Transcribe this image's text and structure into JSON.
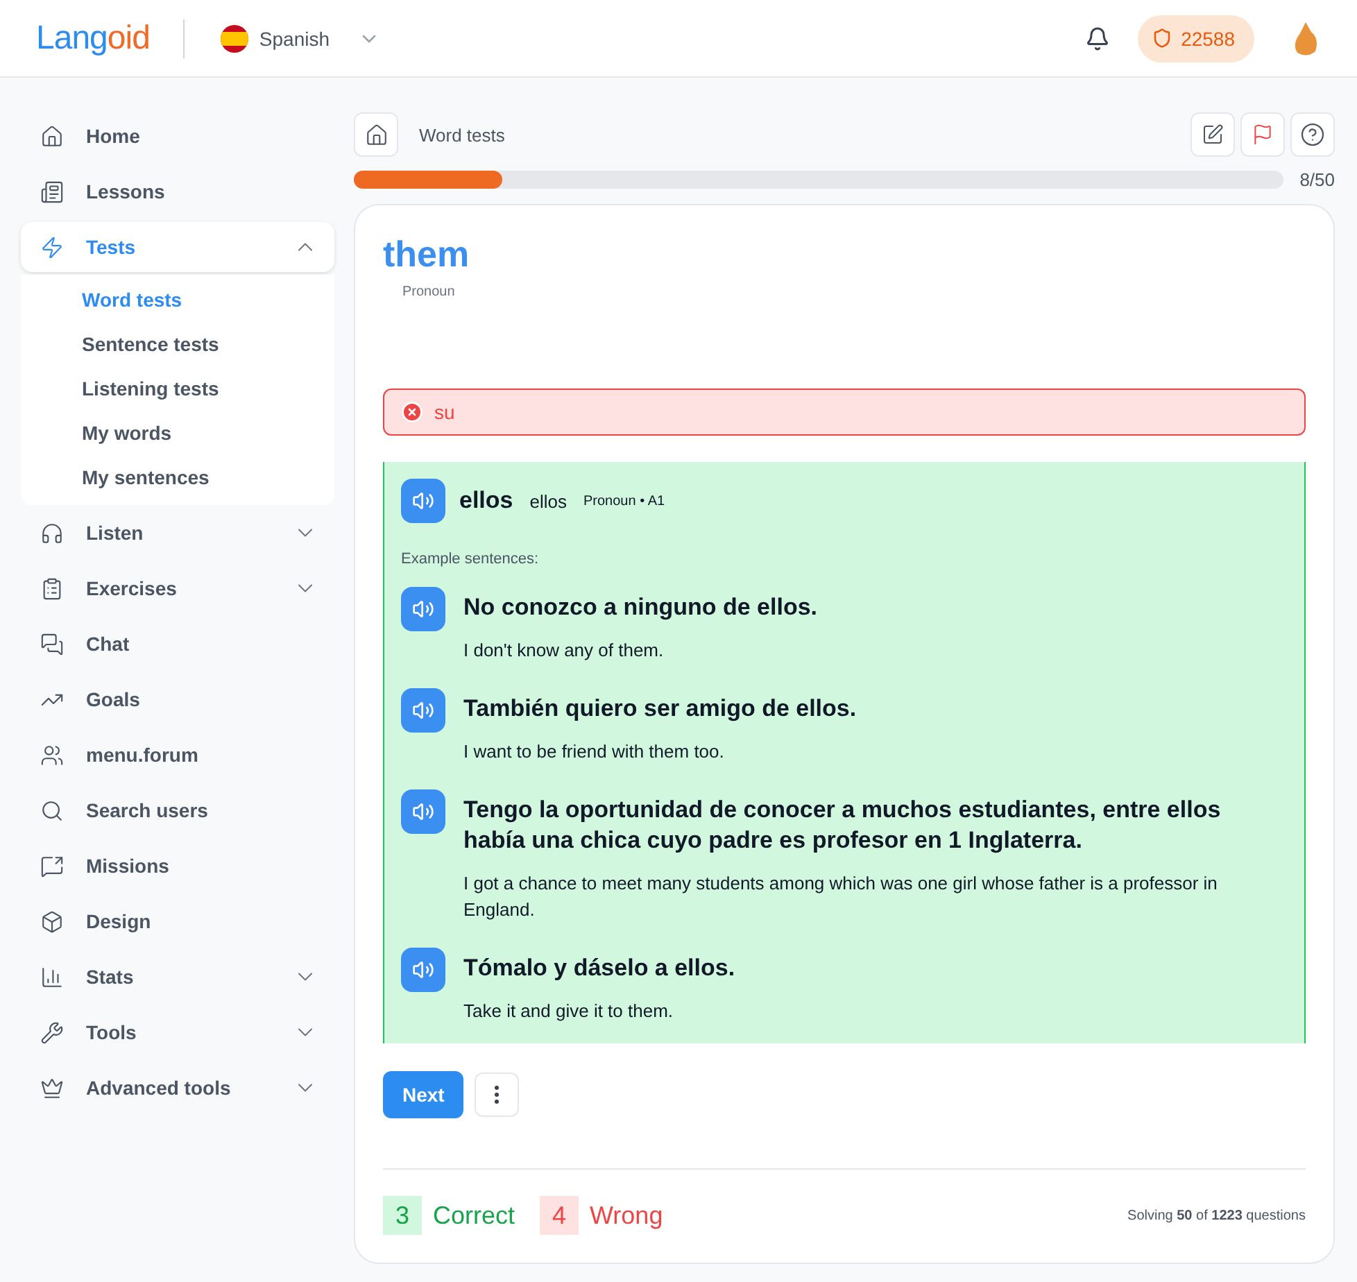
{
  "header": {
    "logo": [
      {
        "text": "Lang",
        "color": "#2d8cf0"
      },
      {
        "text": "oid",
        "color": "#f06a28"
      }
    ],
    "language": "Spanish",
    "points": "22588"
  },
  "sidebar": {
    "items": [
      {
        "label": "Home",
        "selected": false
      },
      {
        "label": "Lessons",
        "selected": false
      },
      {
        "label": "Tests",
        "selected": true,
        "expanded": true,
        "children": [
          {
            "label": "Word tests",
            "selected": true
          },
          {
            "label": "Sentence tests",
            "selected": false
          },
          {
            "label": "Listening tests",
            "selected": false
          },
          {
            "label": "My words",
            "selected": false
          },
          {
            "label": "My sentences",
            "selected": false
          }
        ]
      },
      {
        "label": "Listen",
        "selected": false,
        "expanded": false
      },
      {
        "label": "Exercises",
        "selected": false,
        "expanded": false
      },
      {
        "label": "Chat",
        "selected": false
      },
      {
        "label": "Goals",
        "selected": false
      },
      {
        "label": "menu.forum",
        "selected": false
      },
      {
        "label": "Search users",
        "selected": false
      },
      {
        "label": "Missions",
        "selected": false
      },
      {
        "label": "Design",
        "selected": false
      },
      {
        "label": "Stats",
        "selected": false,
        "expanded": false
      },
      {
        "label": "Tools",
        "selected": false,
        "expanded": false
      },
      {
        "label": "Advanced tools",
        "selected": false,
        "expanded": false
      }
    ]
  },
  "breadcrumb": "Word tests",
  "progress": {
    "level": 0.16,
    "reading": "8/50"
  },
  "question": {
    "word": "them",
    "part_of_speech": "Pronoun"
  },
  "answer": {
    "text": "su",
    "correct": false
  },
  "solution": {
    "word": "ellos",
    "translation": "ellos",
    "meta": "Pronoun • A1",
    "examples_label": "Example sentences:",
    "examples": [
      {
        "sentence": "No conozco a ninguno de ellos.",
        "translation": "I don't know any of them."
      },
      {
        "sentence": "También quiero ser amigo de ellos.",
        "translation": "I want to be friend with them too."
      },
      {
        "sentence": "Tengo la oportunidad de conocer a muchos estudiantes, entre ellos había una chica cuyo padre es profesor en 1 Inglaterra.",
        "translation": "I got a chance to meet many students among which was one girl whose father is a professor in England."
      },
      {
        "sentence": "Tómalo y dáselo a ellos.",
        "translation": "Take it and give it to them."
      }
    ]
  },
  "next_button": "Next",
  "score": {
    "correct": "3",
    "correct_label": "Correct",
    "wrong": "4",
    "wrong_label": "Wrong",
    "status": "Solving **50** of **1223** questions"
  }
}
